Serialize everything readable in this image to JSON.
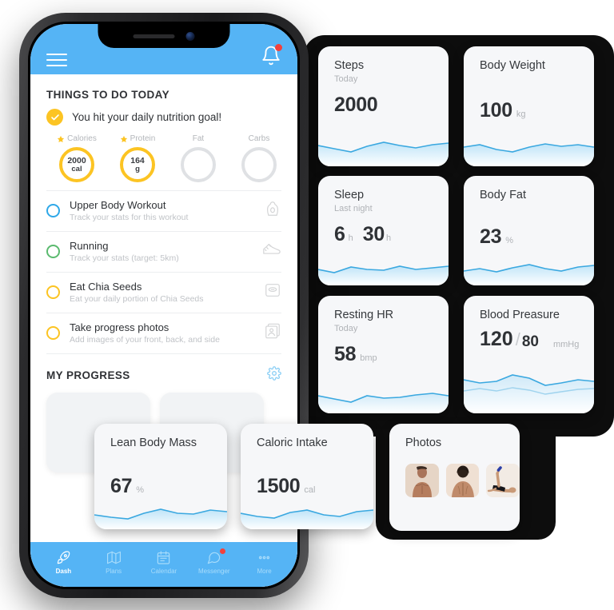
{
  "theme": {
    "header_blue": "#55b4f5",
    "accent_yellow": "#fcc423",
    "badge_red": "#f2413c",
    "spark_blue": "#3aa8e0",
    "card_bg": "#f6f7f9",
    "panel_dark": "#0d0d0d"
  },
  "phone": {
    "header": {
      "menu_icon": "hamburger-menu-icon",
      "bell_icon": "notification-bell-icon",
      "bell_has_badge": true
    },
    "things_to_do": {
      "section_title": "THINGS TO DO TODAY",
      "goal_message": "You hit your daily nutrition goal!",
      "goal_check_icon": "check-circle-icon",
      "macros": [
        {
          "label": "Calories",
          "value": "2000",
          "unit": "cal",
          "starred": true,
          "complete": true
        },
        {
          "label": "Protein",
          "value": "164",
          "unit": "g",
          "starred": true,
          "complete": true
        },
        {
          "label": "Fat",
          "value": "",
          "unit": "",
          "starred": false,
          "complete": false
        },
        {
          "label": "Carbs",
          "value": "",
          "unit": "",
          "starred": false,
          "complete": false
        }
      ],
      "tasks": [
        {
          "title": "Upper Body Workout",
          "subtitle": "Track your stats for this workout",
          "circle_color": "#2fa8e8",
          "icon": "kettlebell-icon"
        },
        {
          "title": "Running",
          "subtitle": "Track your stats (target: 5km)",
          "circle_color": "#5bba6f",
          "icon": "running-shoe-icon"
        },
        {
          "title": "Eat Chia Seeds",
          "subtitle": "Eat your daily portion of Chia Seeds",
          "circle_color": "#fcc423",
          "icon": "weight-scale-icon"
        },
        {
          "title": "Take progress photos",
          "subtitle": "Add images of your front, back, and side",
          "circle_color": "#fcc423",
          "icon": "photos-stack-icon"
        }
      ]
    },
    "my_progress": {
      "section_title": "MY PROGRESS",
      "settings_icon": "gear-icon"
    },
    "bottom_nav": [
      {
        "label": "Dash",
        "icon": "rocket-icon",
        "active": true,
        "badge": false
      },
      {
        "label": "Plans",
        "icon": "map-icon",
        "active": false,
        "badge": false
      },
      {
        "label": "Calendar",
        "icon": "calendar-icon",
        "active": false,
        "badge": false
      },
      {
        "label": "Messenger",
        "icon": "chat-bubble-icon",
        "active": false,
        "badge": true
      },
      {
        "label": "More",
        "icon": "ellipsis-icon",
        "active": false,
        "badge": false
      }
    ]
  },
  "metric_cards": {
    "steps": {
      "title": "Steps",
      "subtitle": "Today",
      "value": "2000",
      "unit": ""
    },
    "body_weight": {
      "title": "Body Weight",
      "subtitle": "",
      "value": "100",
      "unit": "kg"
    },
    "sleep": {
      "title": "Sleep",
      "subtitle": "Last night",
      "hours": "6",
      "hours_unit": "h",
      "minutes": "30",
      "minutes_unit": "h"
    },
    "body_fat": {
      "title": "Body Fat",
      "subtitle": "",
      "value": "23",
      "unit": "%"
    },
    "resting_hr": {
      "title": "Resting HR",
      "subtitle": "Today",
      "value": "58",
      "unit": "bmp"
    },
    "blood_pressure": {
      "title": "Blood Preasure",
      "subtitle": "",
      "systolic": "120",
      "separator": "/",
      "diastolic": "80",
      "unit": "mmHg"
    },
    "lean_body_mass": {
      "title": "Lean Body Mass",
      "subtitle": "",
      "value": "67",
      "unit": "%"
    },
    "caloric_intake": {
      "title": "Caloric Intake",
      "subtitle": "",
      "value": "1500",
      "unit": "cal"
    },
    "photos": {
      "title": "Photos",
      "thumbnails": [
        {
          "name": "front-torso-photo"
        },
        {
          "name": "back-view-photo"
        },
        {
          "name": "exercise-pose-photo"
        }
      ]
    }
  }
}
